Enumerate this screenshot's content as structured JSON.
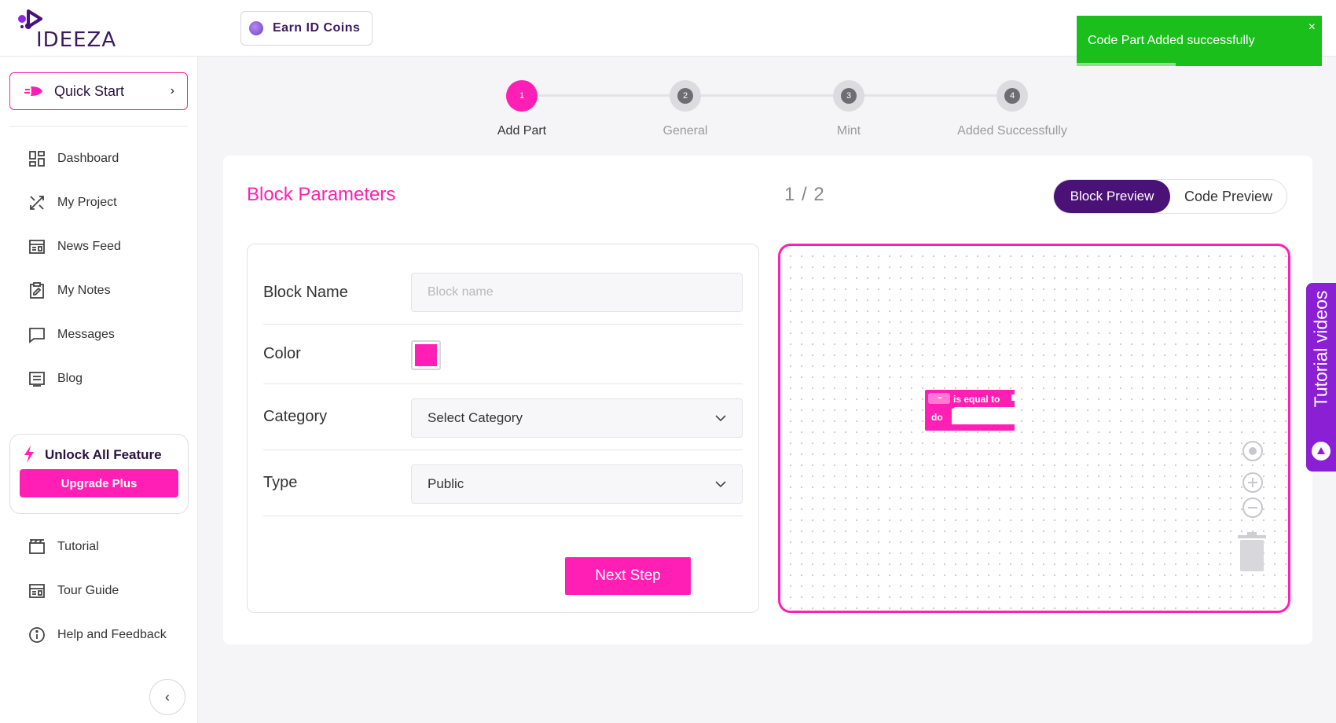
{
  "brand": {
    "logo_text": "IDEEZA"
  },
  "header": {
    "earn_label": "Earn ID Coins"
  },
  "sidebar": {
    "quick_start": "Quick Start",
    "items": [
      {
        "label": "Dashboard",
        "icon": "dashboard-icon"
      },
      {
        "label": "My Project",
        "icon": "project-icon"
      },
      {
        "label": "News Feed",
        "icon": "newsfeed-icon"
      },
      {
        "label": "My Notes",
        "icon": "notes-icon"
      },
      {
        "label": "Messages",
        "icon": "message-icon"
      },
      {
        "label": "Blog",
        "icon": "blog-icon"
      }
    ],
    "unlock_title": "Unlock All Feature",
    "upgrade_label": "Upgrade Plus",
    "bottom_items": [
      {
        "label": "Tutorial",
        "icon": "tutorial-icon"
      },
      {
        "label": "Tour Guide",
        "icon": "tour-guide-icon"
      },
      {
        "label": "Help and Feedback",
        "icon": "info-icon"
      }
    ]
  },
  "stepper": {
    "steps": [
      {
        "num": "1",
        "label": "Add Part",
        "active": true
      },
      {
        "num": "2",
        "label": "General",
        "active": false
      },
      {
        "num": "3",
        "label": "Mint",
        "active": false
      },
      {
        "num": "4",
        "label": "Added Successfully",
        "active": false
      }
    ]
  },
  "main": {
    "title": "Block Parameters",
    "page_indicator": "1 / 2",
    "toggle": {
      "block_preview": "Block Preview",
      "code_preview": "Code Preview",
      "selected": "Block Preview"
    },
    "form": {
      "block_name_label": "Block Name",
      "block_name_placeholder": "Block name",
      "block_name_value": "",
      "color_label": "Color",
      "color_value": "#ff1fb4",
      "category_label": "Category",
      "category_value": "Select Category",
      "type_label": "Type",
      "type_value": "Public",
      "next_label": "Next Step"
    },
    "preview": {
      "block_text_top": "is equal to",
      "block_text_bottom": "do"
    }
  },
  "toast": {
    "message": "Code Part Added successfully",
    "close": "×",
    "color": "#1bbf1b"
  },
  "tutorial_tab": {
    "label": "Tutorial videos"
  },
  "colors": {
    "accent": "#ff1fb4",
    "brand_purple": "#4a1177",
    "tab_purple": "#8a1fd4"
  }
}
